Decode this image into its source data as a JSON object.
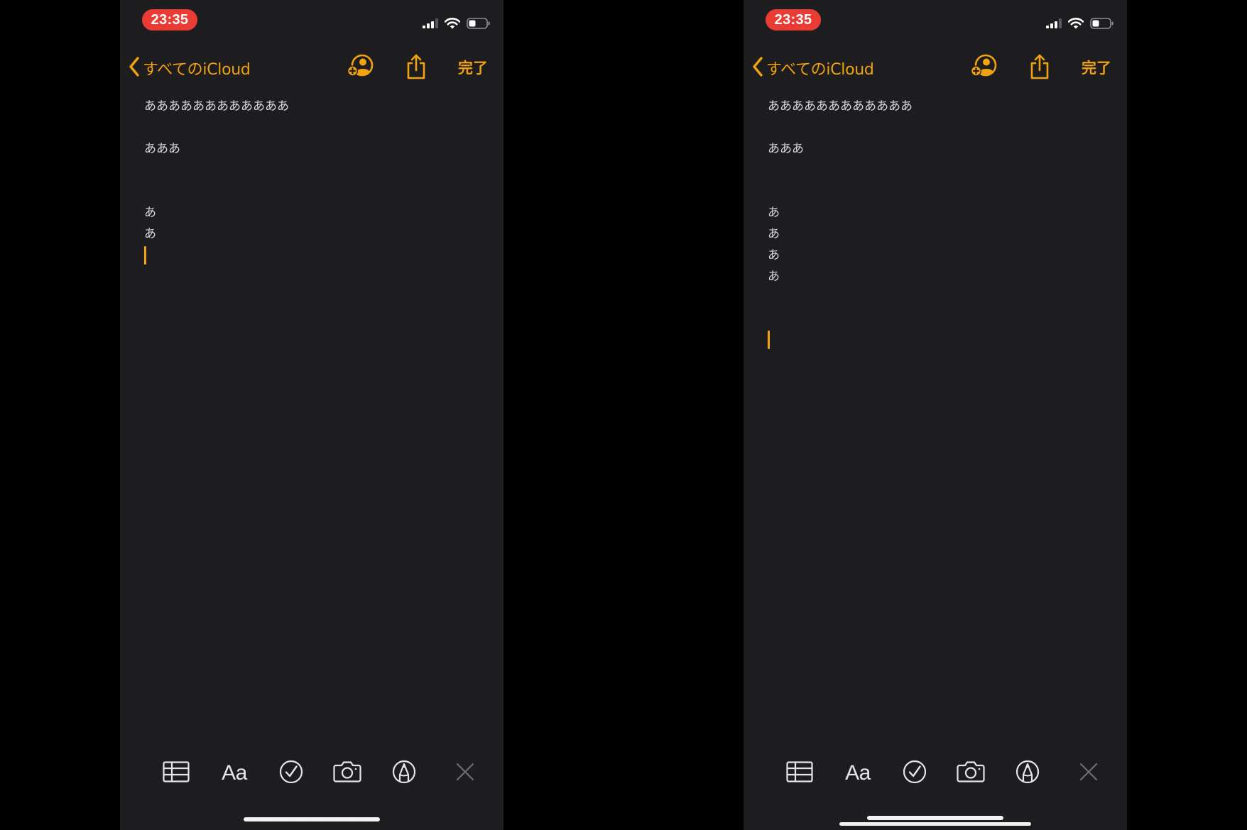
{
  "colors": {
    "accent": "#f2a20f",
    "background": "#1c1c1e",
    "text": "#d6d6d8",
    "time_pill": "#eb3b35"
  },
  "screens": [
    {
      "status_bar": {
        "time": "23:35",
        "icons": [
          "cellular-signal-icon",
          "wifi-icon",
          "battery-icon"
        ]
      },
      "nav": {
        "back_label": "すべてのiCloud",
        "icons": [
          "chevron-left-icon",
          "add-person-icon",
          "share-icon"
        ],
        "done_label": "完了"
      },
      "note_lines": [
        "ああああああああああああ",
        "あああ",
        "あ",
        "あ"
      ],
      "toolbar": {
        "format_label": "Aa",
        "icons": [
          "table-icon",
          "checklist-icon",
          "camera-icon",
          "markup-icon",
          "close-icon"
        ]
      }
    },
    {
      "status_bar": {
        "time": "23:35",
        "icons": [
          "cellular-signal-icon",
          "wifi-icon",
          "battery-icon"
        ]
      },
      "nav": {
        "back_label": "すべてのiCloud",
        "icons": [
          "chevron-left-icon",
          "add-person-icon",
          "share-icon"
        ],
        "done_label": "完了"
      },
      "note_lines": [
        "ああああああああああああ",
        "あああ",
        "あ",
        "あ",
        "あ",
        "あ"
      ],
      "toolbar": {
        "format_label": "Aa",
        "icons": [
          "table-icon",
          "checklist-icon",
          "camera-icon",
          "markup-icon",
          "close-icon"
        ]
      }
    }
  ]
}
